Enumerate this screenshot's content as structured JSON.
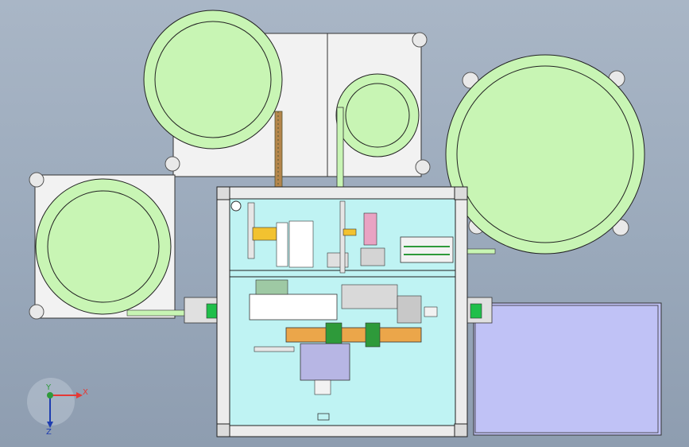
{
  "triad": {
    "x_label": "X",
    "y_label": "Y",
    "z_label": "Z"
  },
  "colors": {
    "background": "#a0aec0",
    "reel": "#c8f5b4",
    "plate": "#f2f2f2",
    "frame_panel": "#bff3f3",
    "output_tray": "#c0c2f6",
    "orange_rail": "#eba64a",
    "purple_block": "#b7b6e4",
    "axis_x": "#e53935",
    "axis_y": "#2e9a3a",
    "axis_z": "#1e3db0"
  }
}
